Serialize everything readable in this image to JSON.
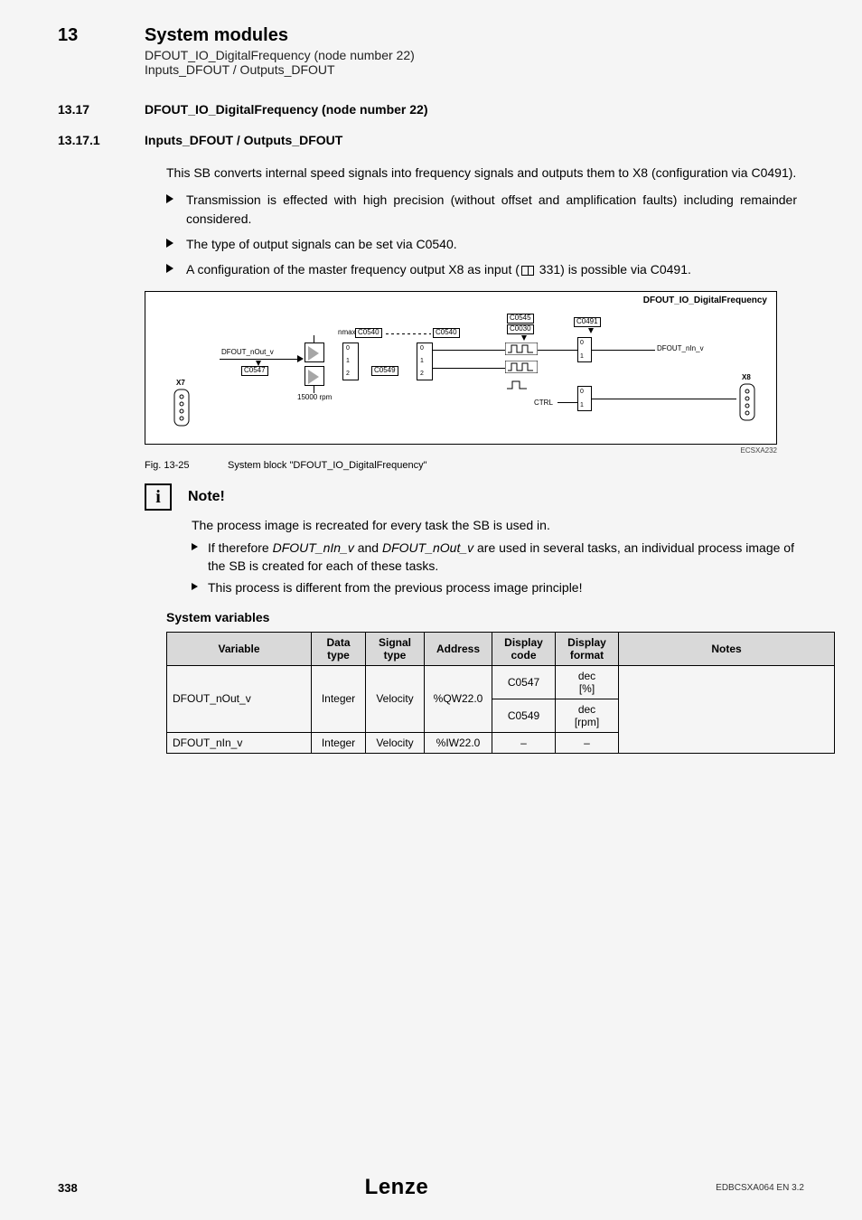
{
  "header": {
    "chapter_num": "13",
    "chapter_title": "System modules",
    "sub1": "DFOUT_IO_DigitalFrequency (node number 22)",
    "sub2": "Inputs_DFOUT / Outputs_DFOUT"
  },
  "sec17": {
    "num": "13.17",
    "title": "DFOUT_IO_DigitalFrequency (node number 22)"
  },
  "sec171": {
    "num": "13.17.1",
    "title": "Inputs_DFOUT / Outputs_DFOUT"
  },
  "para_intro": "This SB converts internal speed signals into frequency signals and outputs them to X8 (configuration via C0491).",
  "bullets": [
    "Transmission is effected with high precision (without offset and amplification faults) including remainder considered.",
    "The type of output signals can be set via C0540.",
    "A configuration of the master frequency output X8 as input (📖 331) is possible via C0491."
  ],
  "diagram": {
    "title": "DFOUT_IO_DigitalFrequency",
    "nmax": "nmax",
    "c0540a": "C0540",
    "c0540b": "C0540",
    "c0545": "C0545",
    "c0030": "C0030",
    "c0491": "C0491",
    "out_label": "DFOUT_nOut_v",
    "in_label": "DFOUT_nIn_v",
    "c0547": "C0547",
    "c0549": "C0549",
    "rpm": "15000 rpm",
    "x7": "X7",
    "x8": "X8",
    "ctrl": "CTRL",
    "mux012a": [
      "0",
      "1",
      "2"
    ],
    "mux012b": [
      "0",
      "1",
      "2"
    ],
    "sw01a": [
      "0",
      "1"
    ],
    "sw01b": [
      "0",
      "1"
    ]
  },
  "ecs": "ECSXA232",
  "fig": {
    "num": "Fig. 13-25",
    "caption": "System block \"DFOUT_IO_DigitalFrequency\""
  },
  "note": {
    "icon": "i",
    "title": "Note!",
    "p1": "The process image is recreated for every task the SB is used in.",
    "b1a": "If therefore ",
    "b1i1": "DFOUT_nIn_v",
    "b1b": " and ",
    "b1i2": "DFOUT_nOut_v",
    "b1c": " are used in several tasks, an individual process image of the SB is created for each of these tasks.",
    "b2": "This process is different from the previous process image principle!"
  },
  "sysvars_title": "System variables",
  "table": {
    "headers": [
      "Variable",
      "Data type",
      "Signal type",
      "Address",
      "Display code",
      "Display format",
      "Notes"
    ],
    "rows": [
      {
        "var": "DFOUT_nOut_v",
        "dtype": "Integer",
        "stype": "Velocity",
        "addr": "%QW22.0",
        "code": "C0547",
        "fmt": "dec\n[%]",
        "notes": ""
      },
      {
        "var": "",
        "dtype": "",
        "stype": "",
        "addr": "",
        "code": "C0549",
        "fmt": "dec\n[rpm]",
        "notes": ""
      },
      {
        "var": "DFOUT_nIn_v",
        "dtype": "Integer",
        "stype": "Velocity",
        "addr": "%IW22.0",
        "code": "–",
        "fmt": "–",
        "notes": ""
      }
    ]
  },
  "footer": {
    "page": "338",
    "brand": "Lenze",
    "docid": "EDBCSXA064 EN 3.2"
  }
}
